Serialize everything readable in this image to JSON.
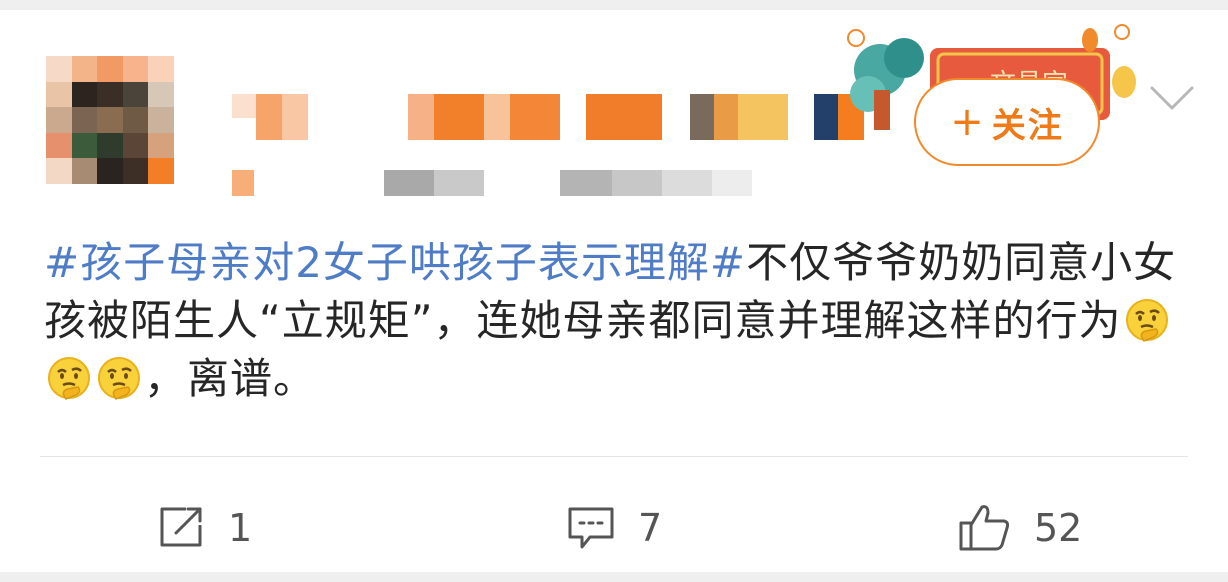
{
  "header": {
    "follow_label": "关注",
    "follow_plus": "+",
    "badge_text": "文昌宫"
  },
  "post": {
    "hashtag": "#孩子母亲对2女子哄孩子表示理解#",
    "text_part1": "不仅爷爷奶奶同意小女孩被陌生人“立规矩”，连她母亲都同意并理解这样的行为",
    "emoji_name": "thinking-face",
    "emoji_count": 3,
    "text_part2": "，离谱。"
  },
  "actions": {
    "share_count": "1",
    "comment_count": "7",
    "like_count": "52"
  },
  "colors": {
    "hashtag": "#4f7cc6",
    "follow": "#ef7a17",
    "text": "#262626",
    "icon": "#555555"
  }
}
